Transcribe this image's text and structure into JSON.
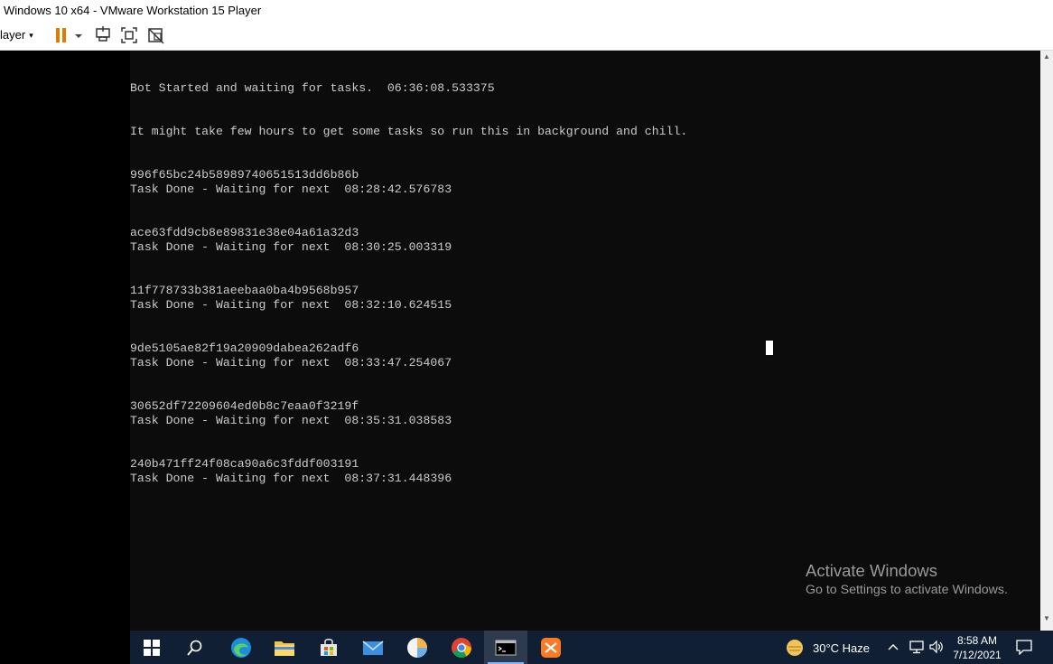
{
  "window": {
    "title": "Windows 10 x64 - VMware Workstation 15 Player"
  },
  "toolbar": {
    "player_label": "layer",
    "player_caret": "▾",
    "buttons": [
      "pause-icon",
      "chevron-down-icon",
      "send-ctrl-alt-del-icon",
      "fullscreen-icon",
      "unity-icon"
    ]
  },
  "console": {
    "lines": [
      {
        "text": "Bot Started and waiting for tasks.  06:36:08.533375"
      },
      {
        "text": "It might take few hours to get some tasks so run this in background and chill."
      },
      {
        "text": "996f65bc24b58989740651513dd6b86b"
      },
      {
        "text": "Task Done - Waiting for next  08:28:42.576783"
      },
      {
        "text": "ace63fdd9cb8e89831e38e04a61a32d3"
      },
      {
        "text": "Task Done - Waiting for next  08:30:25.003319"
      },
      {
        "text": "11f778733b381aeebaa0ba4b9568b957"
      },
      {
        "text": "Task Done - Waiting for next  08:32:10.624515"
      },
      {
        "text": "9de5105ae82f19a20909dabea262adf6"
      },
      {
        "text": "Task Done - Waiting for next  08:33:47.254067"
      },
      {
        "text": "30652df72209604ed0b8c7eaa0f3219f"
      },
      {
        "text": "Task Done - Waiting for next  08:35:31.038583"
      },
      {
        "text": "240b471ff24f08ca90a6c3fddf003191"
      },
      {
        "text": "Task Done - Waiting for next  08:37:31.448396"
      }
    ]
  },
  "watermark": {
    "line1": "Activate Windows",
    "line2": "Go to Settings to activate Windows."
  },
  "taskbar": {
    "apps": [
      "start-icon",
      "search-icon",
      "edge-icon",
      "file-explorer-icon",
      "store-icon",
      "mail-icon",
      "app-icon",
      "chrome-icon",
      "terminal-icon",
      "xampp-icon"
    ],
    "weather": "30°C  Haze",
    "time": "8:58 AM",
    "date": "7/12/2021"
  },
  "colors": {
    "console_bg": "#0c0c0c",
    "console_text": "#cccccc",
    "taskbar_bg": "#101f33"
  }
}
